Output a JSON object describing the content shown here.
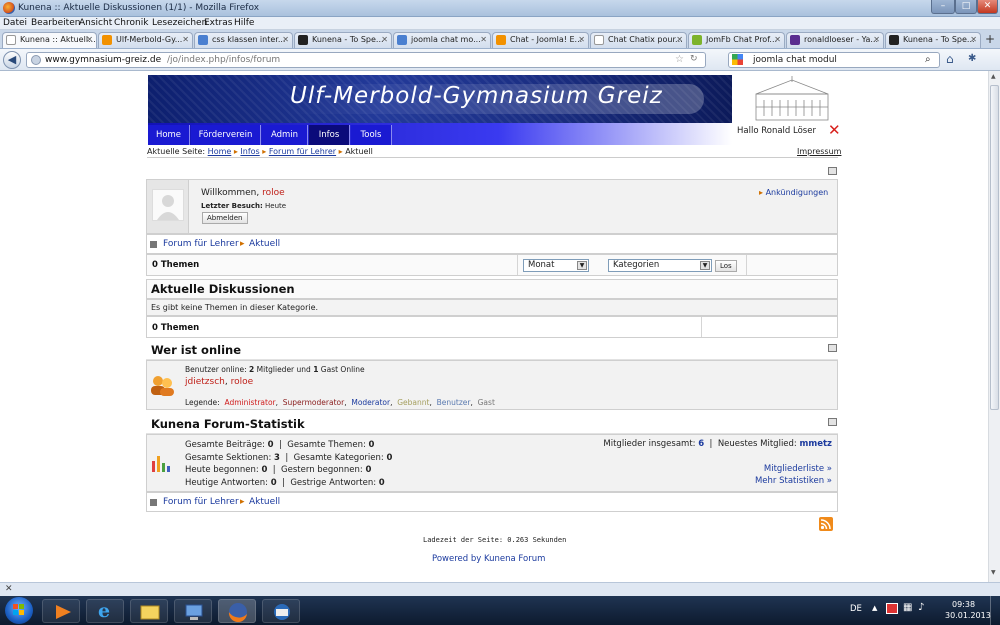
{
  "window": {
    "title": "Kunena :: Aktuelle Diskussionen (1/1) - Mozilla Firefox",
    "minimize": "–",
    "maximize": "□",
    "close": "✕"
  },
  "menubar": [
    "Datei",
    "Bearbeiten",
    "Ansicht",
    "Chronik",
    "Lesezeichen",
    "Extras",
    "Hilfe"
  ],
  "tabs": [
    {
      "label": "Kunena :: Aktuell...",
      "color": "#ffffff"
    },
    {
      "label": "Ulf-Merbold-Gy...",
      "color": "#f29100"
    },
    {
      "label": "css klassen inter...",
      "color": "#4a7fd0"
    },
    {
      "label": "Kunena - To Spe...",
      "color": "#222222"
    },
    {
      "label": "joomla chat mo...",
      "color": "#4a7fd0"
    },
    {
      "label": "Chat - Joomla! E...",
      "color": "#f29100"
    },
    {
      "label": "Chat Chatix pour...",
      "color": "#ffffff"
    },
    {
      "label": "JomFb Chat Prof...",
      "color": "#7db32b"
    },
    {
      "label": "ronaldloeser - Ya...",
      "color": "#5b2d90"
    },
    {
      "label": "Kunena - To Spe...",
      "color": "#222222"
    }
  ],
  "tab_new": "+",
  "nav": {
    "url_host": "www.gymnasium-greiz.de",
    "url_path": "/jo/index.php/infos/forum",
    "search": "joomla chat modul"
  },
  "site": {
    "banner_title": "Ulf-Merbold-Gymnasium Greiz",
    "menu": [
      "Home",
      "Förderverein",
      "Admin",
      "Infos",
      "Tools"
    ],
    "greeting": "Hallo Ronald Löser",
    "breadcrumb_label": "Aktuelle Seite:",
    "breadcrumb": [
      "Home",
      "Infos",
      "Forum für Lehrer",
      "Aktuell"
    ],
    "impressum": "Impressum"
  },
  "welcome": {
    "text": "Willkommen,",
    "user": "roloe",
    "last_visit_label": "Letzter Besuch:",
    "last_visit": "Heute",
    "logout": "Abmelden",
    "announcements": "Ankündigungen"
  },
  "forum_path": [
    "Forum für Lehrer",
    "Aktuell"
  ],
  "filter": {
    "count": "0 Themen",
    "period": "Monat",
    "category": "Kategorien",
    "go": "Los"
  },
  "discussions": {
    "title": "Aktuelle Diskussionen",
    "empty": "Es gibt keine Themen in dieser Kategorie.",
    "count": "0 Themen"
  },
  "online": {
    "title": "Wer ist online",
    "line1_prefix": "Benutzer online:",
    "members": "2",
    "line1_mid": "Mitglieder und",
    "guests": "1",
    "line1_suffix": "Gast Online",
    "users": [
      "jdietzsch",
      "roloe"
    ],
    "legend_label": "Legende:",
    "legend": [
      {
        "label": "Administrator",
        "color": "#d01d1d"
      },
      {
        "label": "Supermoderator",
        "color": "#8a1d1d"
      },
      {
        "label": "Moderator",
        "color": "#1b3a9e"
      },
      {
        "label": "Gebannt",
        "color": "#a6a060"
      },
      {
        "label": "Benutzer",
        "color": "#5a7ab0"
      },
      {
        "label": "Gast",
        "color": "#777777"
      }
    ]
  },
  "stats": {
    "title": "Kunena Forum-Statistik",
    "posts_label": "Gesamte Beiträge:",
    "posts": "0",
    "topics_label": "Gesamte Themen:",
    "topics": "0",
    "sections_label": "Gesamte Sektionen:",
    "sections": "3",
    "categories_label": "Gesamte Kategorien:",
    "categories": "0",
    "today_label": "Heute begonnen:",
    "today": "0",
    "yesterday_label": "Gestern begonnen:",
    "yesterday": "0",
    "replies_today_label": "Heutige Antworten:",
    "replies_today": "0",
    "replies_yesterday_label": "Gestrige Antworten:",
    "replies_yesterday": "0",
    "members_label": "Mitglieder insgesamt:",
    "members": "6",
    "newest_label": "Neuestes Mitglied:",
    "newest": "mmetz",
    "memberlist": "Mitgliederliste »",
    "more_stats": "Mehr Statistiken »"
  },
  "footer": {
    "loadtime": "Ladezeit der Seite: 0.263 Sekunden",
    "powered": "Powered by Kunena Forum"
  },
  "taskbar": {
    "lang": "DE",
    "time": "09:38",
    "date": "30.01.2013"
  }
}
